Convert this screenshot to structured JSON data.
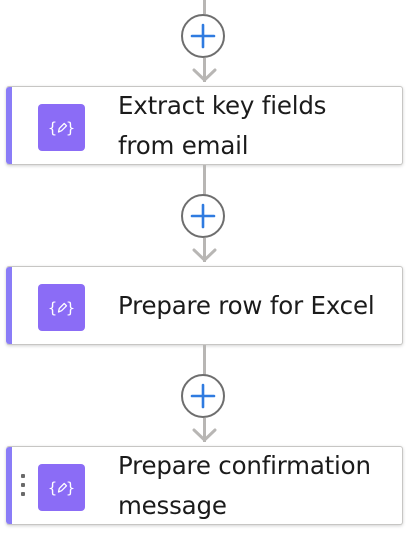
{
  "flow": {
    "accent_color": "#8a7cf7",
    "tile_color": "#8b6cf6",
    "add_color": "#2f7be0",
    "connector_color": "#b8b6b4",
    "add_button_icon": "plus-icon",
    "action_icon": "compose-braces-pencil-icon",
    "steps": [
      {
        "title": "Extract key fields from email"
      },
      {
        "title": "Prepare row for Excel"
      },
      {
        "title": "Prepare confirmation message"
      }
    ]
  }
}
